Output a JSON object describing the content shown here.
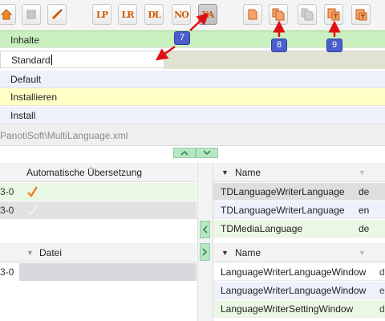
{
  "toolbar": {
    "buttons": [
      {
        "name": "house-icon",
        "glyph": ""
      },
      {
        "name": "stop-icon",
        "glyph": ""
      },
      {
        "name": "brush-icon",
        "glyph": ""
      },
      {
        "name": "lp-icon",
        "glyph": "LP"
      },
      {
        "name": "lr-icon",
        "glyph": "LR"
      },
      {
        "name": "dl-icon",
        "glyph": "DL"
      },
      {
        "name": "no-icon",
        "glyph": "NO"
      },
      {
        "name": "xa-icon",
        "glyph": "XA"
      },
      {
        "name": "page-icon",
        "glyph": ""
      },
      {
        "name": "copy-icon",
        "glyph": ""
      },
      {
        "name": "copy-disabled-icon",
        "glyph": ""
      },
      {
        "name": "translate-icon",
        "glyph": ""
      },
      {
        "name": "paste-icon",
        "glyph": ""
      }
    ]
  },
  "languages": {
    "inhalte": "Inhalte",
    "standard": "Standard",
    "default": "Default",
    "installieren": "Installieren",
    "install": "Install"
  },
  "path": "PanotiSoft\\MultiLanguage.xml",
  "left_panel_1": {
    "header": "Automatische Übersetzung",
    "rows": [
      {
        "cut": "3-0",
        "checked": true
      },
      {
        "cut": "3-0",
        "checked": false
      }
    ]
  },
  "left_panel_2": {
    "header": "Datei",
    "rows": [
      {
        "cut": "3-0"
      }
    ]
  },
  "right_panel_1": {
    "header": "Name",
    "rows": [
      {
        "name": "TDLanguageWriterLanguage",
        "lang": "de"
      },
      {
        "name": "TDLanguageWriterLanguage",
        "lang": "en"
      },
      {
        "name": "TDMediaLanguage",
        "lang": "de"
      }
    ]
  },
  "right_panel_2": {
    "header": "Name",
    "rows": [
      {
        "name": "LanguageWriterLanguageWindow",
        "trail": "d"
      },
      {
        "name": "LanguageWriterLanguageWindow",
        "trail": "e"
      },
      {
        "name": "LanguageWriterSettingWindow",
        "trail": "d"
      }
    ]
  },
  "markers": {
    "m7": "7",
    "m8": "8",
    "m9": "9"
  },
  "colors": {
    "accent_orange": "#d35a00",
    "marker_blue": "#4a5fcc",
    "arrow_red": "#e01010",
    "inhalte_green": "#c9f0be",
    "installieren_yellow": "#ffffc6"
  }
}
